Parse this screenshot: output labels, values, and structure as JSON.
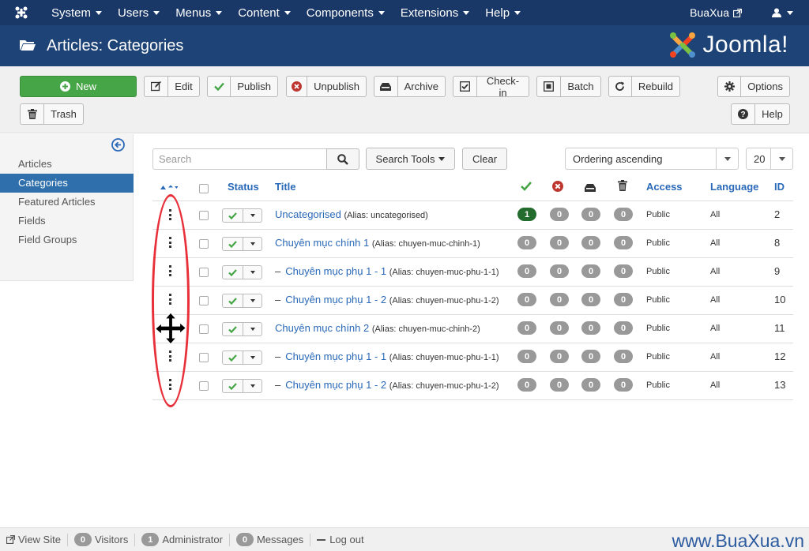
{
  "navbar": {
    "menus": [
      "System",
      "Users",
      "Menus",
      "Content",
      "Components",
      "Extensions",
      "Help"
    ],
    "site_name": "BuaXua"
  },
  "header": {
    "title": "Articles: Categories",
    "brand": "Joomla!"
  },
  "toolbar": {
    "new": "New",
    "edit": "Edit",
    "publish": "Publish",
    "unpublish": "Unpublish",
    "archive": "Archive",
    "checkin": "Check-in",
    "batch": "Batch",
    "rebuild": "Rebuild",
    "options": "Options",
    "trash": "Trash",
    "help": "Help"
  },
  "sidebar": {
    "items": [
      {
        "label": "Articles"
      },
      {
        "label": "Categories"
      },
      {
        "label": "Featured Articles"
      },
      {
        "label": "Fields"
      },
      {
        "label": "Field Groups"
      }
    ]
  },
  "filters": {
    "search_placeholder": "Search",
    "search_tools": "Search Tools",
    "clear": "Clear",
    "ordering": "Ordering ascending",
    "limit": "20"
  },
  "table": {
    "headers": {
      "status": "Status",
      "title": "Title",
      "access": "Access",
      "language": "Language",
      "id": "ID"
    },
    "rows": [
      {
        "indent": false,
        "title": "Uncategorised",
        "alias": "(Alias: uncategorised)",
        "published": "1",
        "unpublished": "0",
        "archived": "0",
        "trashed": "0",
        "access": "Public",
        "language": "All",
        "id": "2"
      },
      {
        "indent": false,
        "title": "Chuyên mục chính 1",
        "alias": "(Alias: chuyen-muc-chinh-1)",
        "published": "0",
        "unpublished": "0",
        "archived": "0",
        "trashed": "0",
        "access": "Public",
        "language": "All",
        "id": "8"
      },
      {
        "indent": true,
        "title": "Chuyên mục phụ 1 - 1",
        "alias": "(Alias: chuyen-muc-phu-1-1)",
        "published": "0",
        "unpublished": "0",
        "archived": "0",
        "trashed": "0",
        "access": "Public",
        "language": "All",
        "id": "9"
      },
      {
        "indent": true,
        "title": "Chuyên mục phụ 1 - 2",
        "alias": "(Alias: chuyen-muc-phu-1-2)",
        "published": "0",
        "unpublished": "0",
        "archived": "0",
        "trashed": "0",
        "access": "Public",
        "language": "All",
        "id": "10"
      },
      {
        "indent": false,
        "title": "Chuyên mục chính 2",
        "alias": "(Alias: chuyen-muc-chinh-2)",
        "published": "0",
        "unpublished": "0",
        "archived": "0",
        "trashed": "0",
        "access": "Public",
        "language": "All",
        "id": "11"
      },
      {
        "indent": true,
        "title": "Chuyên mục phụ 1 - 1",
        "alias": "(Alias: chuyen-muc-phu-1-1)",
        "published": "0",
        "unpublished": "0",
        "archived": "0",
        "trashed": "0",
        "access": "Public",
        "language": "All",
        "id": "12"
      },
      {
        "indent": true,
        "title": "Chuyên mục phụ 1 - 2",
        "alias": "(Alias: chuyen-muc-phu-1-2)",
        "published": "0",
        "unpublished": "0",
        "archived": "0",
        "trashed": "0",
        "access": "Public",
        "language": "All",
        "id": "13"
      }
    ]
  },
  "statusbar": {
    "view_site": "View Site",
    "visitors_count": "0",
    "visitors": "Visitors",
    "admin_count": "1",
    "admin": "Administrator",
    "messages_count": "0",
    "messages": "Messages",
    "logout": "Log out"
  },
  "watermark": "www.BuaXua.vn",
  "colors": {
    "navbar": "#1a3867",
    "header": "#1e4477",
    "link": "#2a69b8",
    "new_button": "#46a546",
    "annotation": "#e8303a"
  }
}
